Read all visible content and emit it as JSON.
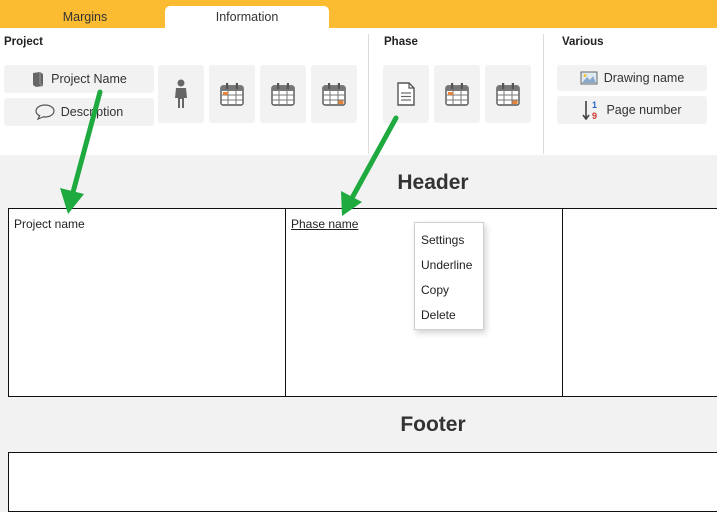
{
  "tabs": [
    {
      "label": "Margins",
      "active": false
    },
    {
      "label": "Information",
      "active": true
    }
  ],
  "ribbon": {
    "project": {
      "title": "Project",
      "project_name_label": "Project Name",
      "description_label": "Description"
    },
    "phase": {
      "title": "Phase"
    },
    "various": {
      "title": "Various",
      "drawing_name_label": "Drawing name",
      "page_number_label": "Page number"
    }
  },
  "canvas": {
    "header_title": "Header",
    "footer_title": "Footer",
    "cells": [
      {
        "text": "Project name"
      },
      {
        "text": "Phase name"
      },
      {
        "text": ""
      }
    ]
  },
  "context_menu": {
    "items": [
      "Settings",
      "Underline",
      "Copy",
      "Delete"
    ]
  },
  "colors": {
    "tabbar": "#fbbc32",
    "arrow": "#1faa3f",
    "calendar_accent": "#e8833a"
  },
  "icons": {
    "project_name": "book-icon",
    "description": "speech-bubble-icon",
    "person": "person-icon",
    "calendar": "calendar-icon",
    "document": "document-icon",
    "drawing": "image-icon",
    "page_number": "sort-number-icon"
  }
}
